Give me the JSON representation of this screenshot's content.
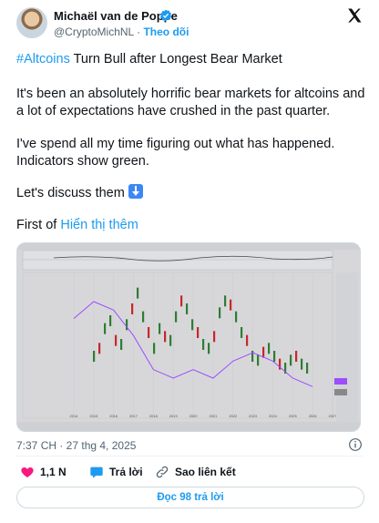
{
  "author": {
    "name": "Michaël van de Poppe",
    "handle": "@CryptoMichNL",
    "separator": "·",
    "follow_label": "Theo dõi"
  },
  "icons": {
    "verified": "verified-badge-icon",
    "logo": "x-logo-icon",
    "info": "info-icon",
    "like": "heart-icon",
    "reply": "comment-icon",
    "copy": "link-icon",
    "emoji": "down-arrow-emoji"
  },
  "colors": {
    "accent": "#1d9bf0",
    "like": "#f91880",
    "chart_bg": "#d7d7da",
    "up": "#2e7d32",
    "down": "#c62828",
    "overlay": "#9b4dff"
  },
  "tweet": {
    "line1_hashtag": "#Altcoins",
    "line1_rest": " Turn Bull after Longest Bear Market",
    "para2": "It's been an absolutely horrific bear markets for altcoins and a lot of expectations have crushed in the past quarter.",
    "para3": "I've spend all my time figuring out what has happened. Indicators show green.",
    "para4": "Let's discuss them ",
    "para5_prefix": "First of ",
    "show_more": "Hiển thị thêm"
  },
  "chart_data": {
    "type": "line",
    "x": [
      "2014",
      "2015",
      "2016",
      "2017",
      "2018",
      "2019",
      "2020",
      "2021",
      "2022",
      "2023",
      "2024",
      "2025",
      "2026",
      "2027"
    ],
    "series": [
      {
        "values": [
          0.15,
          0.17,
          0.16,
          0.13,
          0.09,
          0.08,
          0.09,
          0.08,
          0.1,
          0.11,
          0.1,
          0.08,
          0.07
        ]
      }
    ]
  },
  "footer": {
    "timestamp": "7:37 CH · 27 thg 4, 2025",
    "like_count": "1,1 N",
    "reply_label": "Trả lời",
    "copy_label": "Sao liên kết",
    "read_replies": "Đọc 98 trả lời"
  }
}
